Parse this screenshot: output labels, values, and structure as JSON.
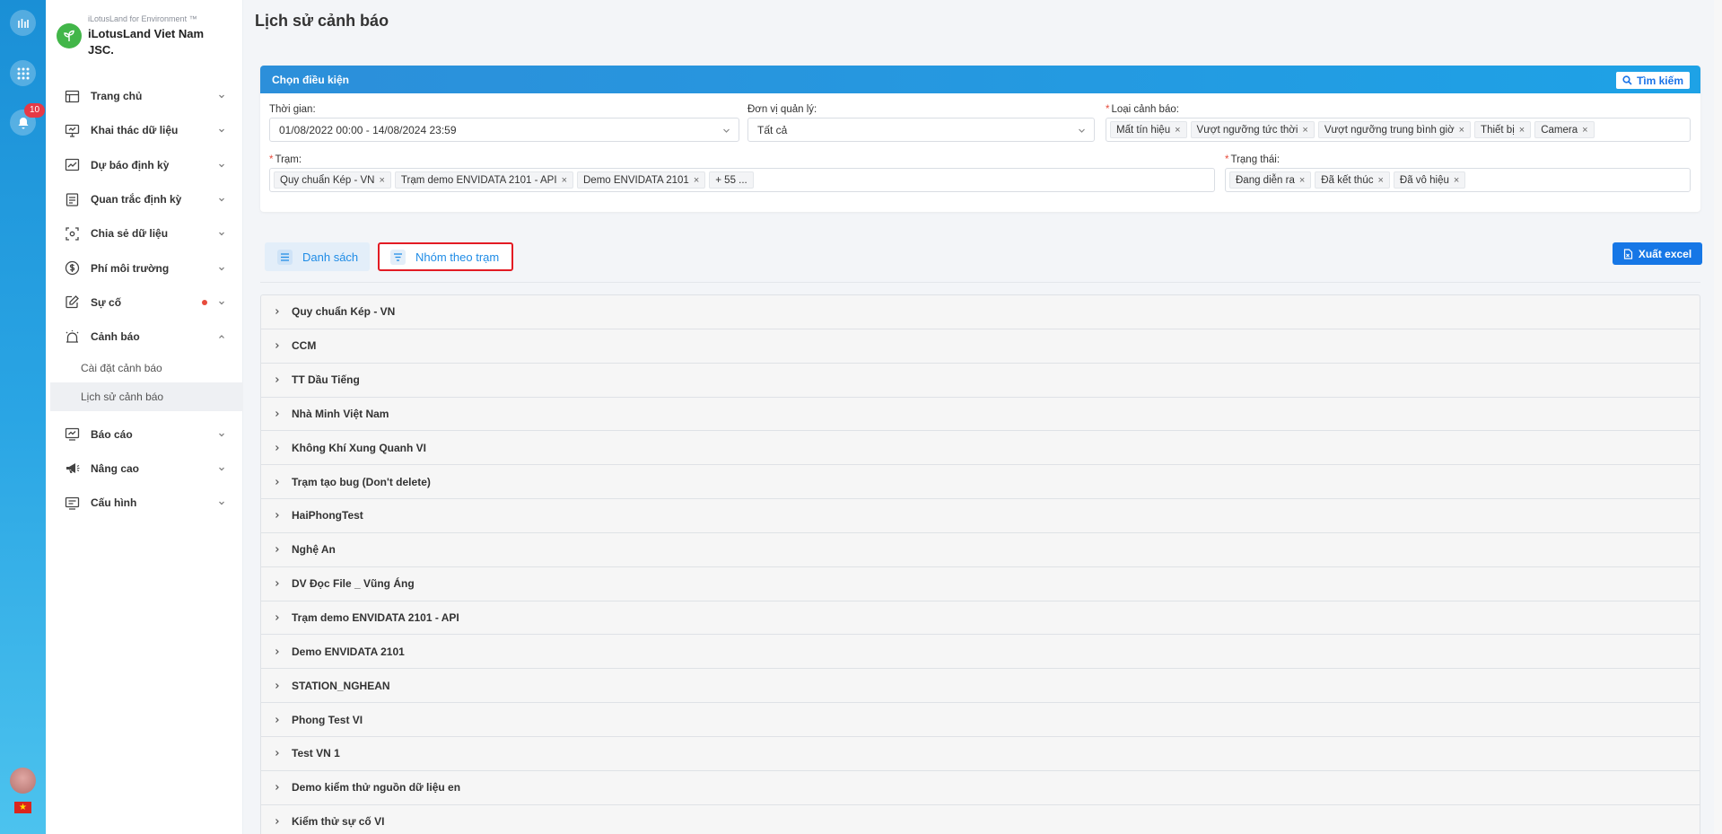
{
  "rail": {
    "notification_count": "10",
    "flag_glyph": "★"
  },
  "org": {
    "subtitle": "iLotusLand for Environment ™",
    "name": "iLotusLand Viet Nam JSC."
  },
  "nav": {
    "items": [
      {
        "label": "Trang chủ",
        "icon": "home-icon"
      },
      {
        "label": "Khai thác dữ liệu",
        "icon": "monitor-icon"
      },
      {
        "label": "Dự báo định kỳ",
        "icon": "chart-line-icon"
      },
      {
        "label": "Quan trắc định kỳ",
        "icon": "clipboard-icon"
      },
      {
        "label": "Chia sẻ dữ liệu",
        "icon": "share-icon"
      },
      {
        "label": "Phí môi trường",
        "icon": "dollar-icon"
      },
      {
        "label": "Sự cố",
        "icon": "edit-icon"
      },
      {
        "label": "Cảnh báo",
        "icon": "alarm-icon"
      }
    ],
    "sub_items": [
      "Cài đặt cảnh báo",
      "Lịch sử cảnh báo"
    ],
    "bottom_items": [
      {
        "label": "Báo cáo",
        "icon": "report-icon"
      },
      {
        "label": "Nâng cao",
        "icon": "megaphone-icon"
      },
      {
        "label": "Cấu hình",
        "icon": "settings-monitor-icon"
      }
    ]
  },
  "page": {
    "title": "Lịch sử cảnh báo"
  },
  "filter": {
    "header": "Chọn điều kiện",
    "search_label": "Tìm kiếm",
    "time_label": "Thời gian:",
    "time_value": "01/08/2022 00:00 - 14/08/2024 23:59",
    "unit_label": "Đơn vị quản lý:",
    "unit_value": "Tất cả",
    "alert_type_label": "Loại cảnh báo:",
    "alert_types": [
      "Mất tín hiệu",
      "Vượt ngưỡng tức thời",
      "Vượt ngưỡng trung bình giờ",
      "Thiết bị",
      "Camera"
    ],
    "station_label": "Trạm:",
    "stations": [
      "Quy chuẩn Kép - VN",
      "Trạm demo ENVIDATA 2101 - API",
      "Demo ENVIDATA 2101"
    ],
    "stations_more": "+ 55 ...",
    "status_label": "Trạng thái:",
    "statuses": [
      "Đang diễn ra",
      "Đã kết thúc",
      "Đã vô hiệu"
    ],
    "remove_glyph": "×"
  },
  "view": {
    "tab_list": "Danh sách",
    "tab_group": "Nhóm theo trạm",
    "export": "Xuất excel"
  },
  "groups": [
    "Quy chuẩn Kép - VN",
    "CCM",
    "TT Dầu Tiếng",
    "Nhà Minh Việt Nam",
    "Không Khí Xung Quanh VI",
    "Trạm tạo bug (Don't delete)",
    "HaiPhongTest",
    "Nghệ An",
    "DV Đọc File _ Vũng Áng",
    "Trạm demo ENVIDATA 2101 - API",
    "Demo ENVIDATA 2101",
    "STATION_NGHEAN",
    "Phong Test VI",
    "Test VN 1",
    "Demo kiểm thử nguồn dữ liệu en",
    "Kiểm thử sự cố VI"
  ]
}
